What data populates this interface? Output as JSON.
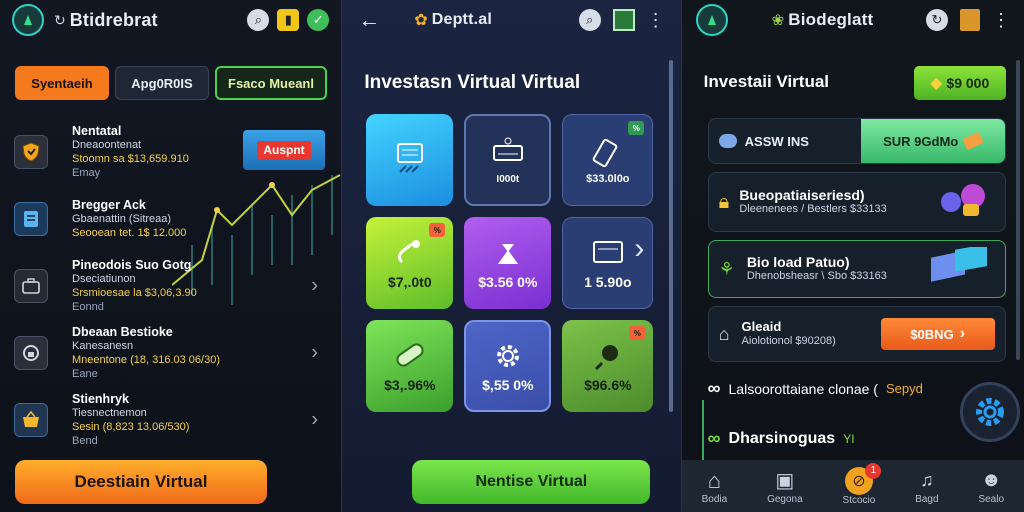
{
  "panel1": {
    "title": "Btidrebrat",
    "tabs": [
      "Syentaeih",
      "Apg0R0IS",
      "Fsaco Mueanl"
    ],
    "invest_badge": "Auspnt",
    "rows": [
      {
        "h": "Nentatal",
        "s": "Dneaoontenat",
        "g": "Stoomn sa $13,659.910",
        "d": "Emay"
      },
      {
        "h": "Bregger Ack",
        "s": "Gbaenattin (Sitreaa)",
        "g": "Seooean tet. 1$ 12.000",
        "d": ""
      },
      {
        "h": "Pineodois Suo Gotg",
        "s": "Dseciatiunon",
        "g": "Srsmioesae la $3,06,3.90",
        "d": "Eonnd"
      },
      {
        "h": "Dbeaan Bestioke",
        "s": "Kanesanesn",
        "g": "Mneentone (18, 316.03 06/30)",
        "d": "Eane"
      },
      {
        "h": "Stienhryk",
        "s": "Tiesnectnemon",
        "g": "Sesin (8,823 13.06/530)",
        "d": "Bend"
      }
    ],
    "cta": "Deestiain Virtual"
  },
  "panel2": {
    "title": "Deptt.al",
    "heading": "Investasn Virtual Virtual",
    "tiles": [
      {
        "label": "",
        "badge": ""
      },
      {
        "label": "I000t",
        "badge": ""
      },
      {
        "label": "$33.0l0o",
        "badge": "%"
      },
      {
        "label": "$7,.0t0",
        "badge": "%"
      },
      {
        "label": "$3.56 0%",
        "badge": ""
      },
      {
        "label": "1 5.90o",
        "badge": ""
      },
      {
        "label": "$3,.96%",
        "badge": ""
      },
      {
        "label": "$,55 0%",
        "badge": ""
      },
      {
        "label": "$96.6%",
        "badge": "%"
      }
    ],
    "cta": "Nentise Virtual"
  },
  "panel3": {
    "title": "Biodeglatt",
    "heading": "Investaii Virtual",
    "balance_btn": "$9 000",
    "cards": [
      {
        "h": "ASSW INS",
        "btn": "SUR 9GdMo"
      },
      {
        "h": "Bueopatiaiseriesd)",
        "s": "Dleenenees / Bestlers $33133"
      },
      {
        "h": "Bio load Patuo)",
        "s": "Dhenobsheasr \\ Sbo $33163"
      },
      {
        "h": "Gleaid",
        "s": "Aiolotionol $90208)",
        "btn": "$0BNG"
      }
    ],
    "line1": "Lalsoorottaiane clonae (",
    "line1_tag": "Sepyd",
    "line2": "Dharsinoguas",
    "nav": [
      "Bodia",
      "Gegona",
      "Stcocio",
      "Bagd",
      "Sealo"
    ],
    "nav_badge": "1"
  }
}
